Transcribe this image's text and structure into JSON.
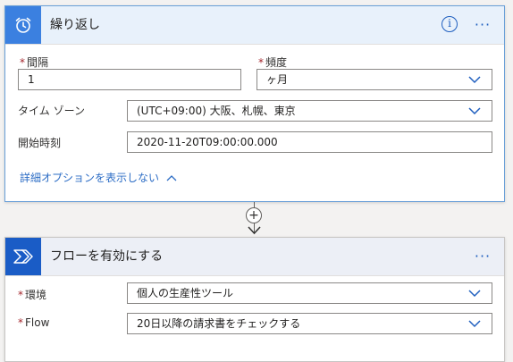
{
  "recurrence": {
    "title": "繰り返し",
    "interval_label": "間隔",
    "interval_value": "1",
    "frequency_label": "頻度",
    "frequency_value": "ヶ月",
    "timezone_label": "タイム ゾーン",
    "timezone_value": "(UTC+09:00) 大阪、札幌、東京",
    "start_label": "開始時刻",
    "start_value": "2020-11-20T09:00:00.000",
    "advanced_label": "詳細オプションを表示しない",
    "info_glyph": "i",
    "more_glyph": "···"
  },
  "enable_flow": {
    "title": "フローを有効にする",
    "environment_label": "環境",
    "environment_value": "個人の生産性ツール",
    "flow_label": "Flow",
    "flow_value": "20日以降の請求書をチェックする",
    "more_glyph": "···"
  },
  "connector": {
    "add_glyph": "+"
  },
  "required_mark": "*",
  "colors": {
    "recurrence_accent": "#3b80e0",
    "flow_accent": "#1a5cc6",
    "link": "#2b6cc5",
    "required": "#a4262c"
  },
  "icons": {
    "recurrence": "alarm-clock-icon",
    "flow": "power-automate-icon",
    "dropdown": "chevron-down-icon",
    "collapse": "chevron-up-icon"
  }
}
